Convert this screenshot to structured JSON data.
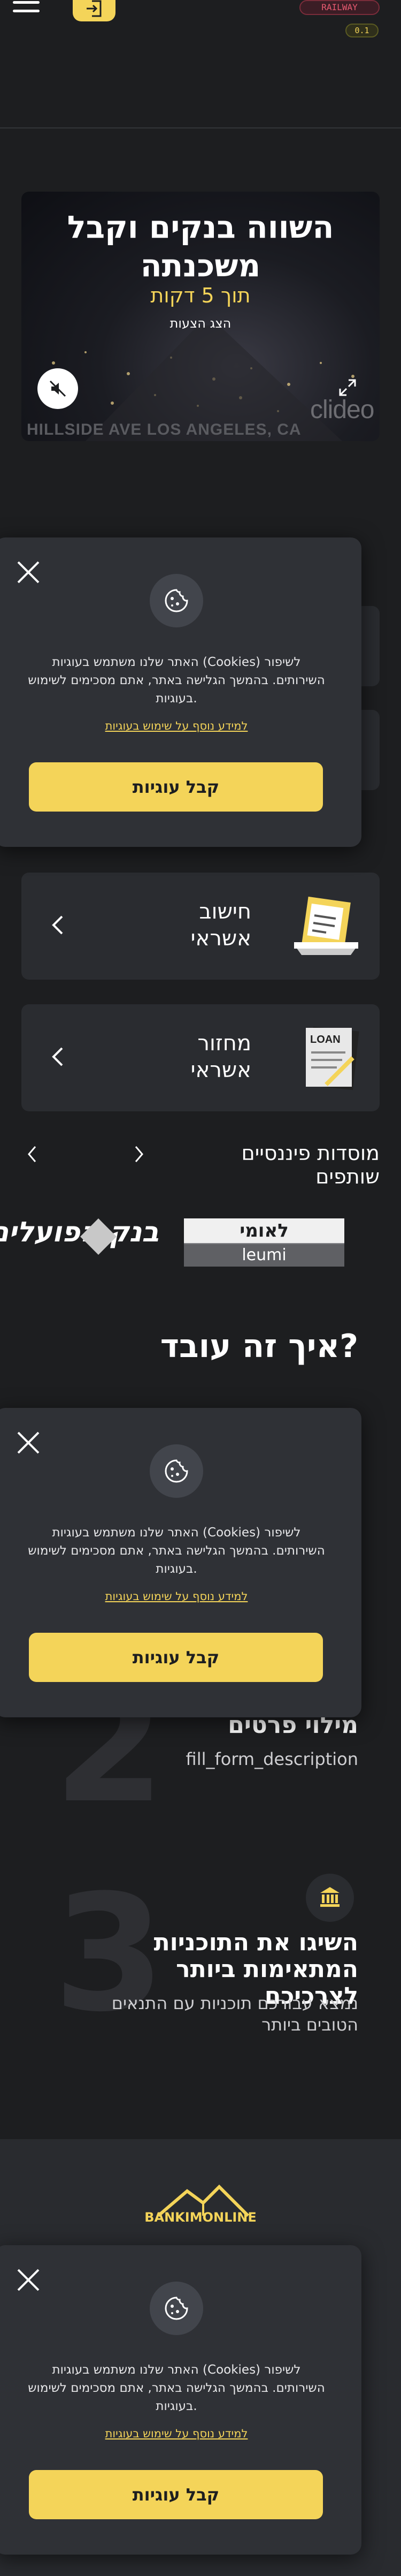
{
  "header": {
    "menu_icon": "hamburger-icon",
    "login_icon": "login-icon",
    "env_badge": "RAILWAY",
    "version_badge": "0.1"
  },
  "hero": {
    "title": "השווה בנקים וקבל משכנתה",
    "subtitle": "תוך 5 דקות",
    "offers_link": "הצג הצעות",
    "watermark": "clideo",
    "street_text": "HILLSIDE AVE  LOS ANGELES, CA"
  },
  "services": [
    {
      "title_line1": "חישוב",
      "title_line2": "אשראי",
      "icon": "calculator-icon"
    },
    {
      "title_line1": "מחזור",
      "title_line2": "אשראי",
      "icon": "loan-document-icon",
      "icon_text": "LOAN"
    }
  ],
  "partners": {
    "title": "מוסדות פיננסיים שותפים",
    "banks": [
      {
        "name": "בנק הפועלים"
      },
      {
        "name_he": "לאומי",
        "name_en": "leumi"
      }
    ]
  },
  "how_it_works": {
    "title": "איך זה עובד?",
    "steps": [
      {
        "number": "2",
        "title": "מילוי פרטים",
        "description": "fill_form_description"
      },
      {
        "number": "3",
        "title": "השיגו את התוכניות המתאימות ביותר לצרכיכם",
        "description": "נמצא עבורכם תוכניות עם התנאים הטובים ביותר"
      }
    ]
  },
  "footer": {
    "logo_text": "BANKIMONLINE"
  },
  "cookie_banner": {
    "text": "האתר שלנו משתמש בעוגיות (Cookies) לשיפור השירותים. בהמשך הגלישה באתר, אתם מסכימים לשימוש בעוגיות.",
    "link": "למידע נוסף על שימוש בעוגיות",
    "accept": "קבל עוגיות"
  },
  "colors": {
    "background": "#1d1e20",
    "accent": "#f4d459",
    "card": "#2a2c30"
  }
}
